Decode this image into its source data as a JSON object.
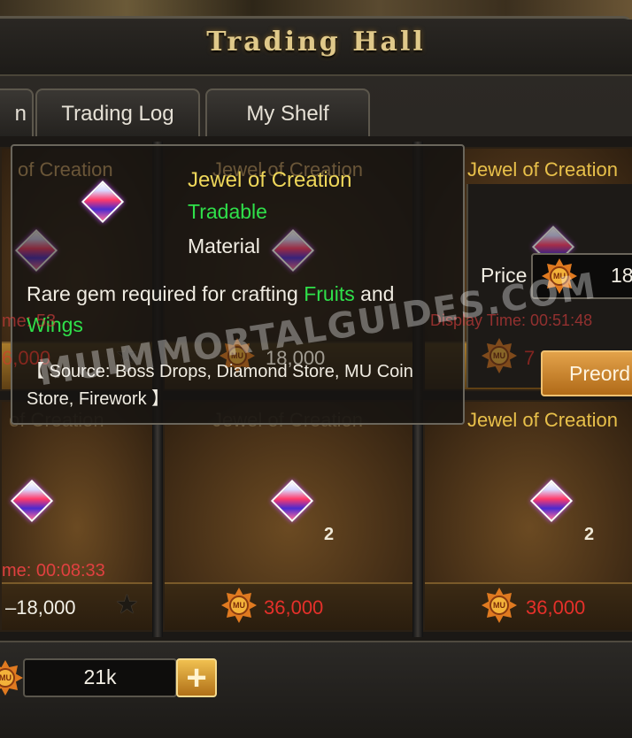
{
  "window": {
    "title": "Trading Hall"
  },
  "tabs": [
    {
      "label": "n"
    },
    {
      "label": "Trading Log"
    },
    {
      "label": "My Shelf"
    }
  ],
  "cards_top": [
    {
      "name": "of Creation",
      "timer": "me: 53",
      "price": "6,000"
    },
    {
      "name": "Jewel of Creation",
      "price": "18,000"
    },
    {
      "name": "Jewel of Creation",
      "timer": "Display Time: 00:51:48",
      "price": "7"
    }
  ],
  "cards_bottom": [
    {
      "name": "of Creation",
      "timer": "me:  00:08:33",
      "price": "18,000",
      "favorite": "star-icon"
    },
    {
      "name": "Jewel of Creation",
      "qty": "2",
      "price": "36,000"
    },
    {
      "name": "Jewel of Creation",
      "qty": "2",
      "price": "36,000"
    }
  ],
  "tooltip": {
    "item_name": "Jewel of Creation",
    "tradable": "Tradable",
    "type": "Material",
    "desc_pre": "Rare gem required for crafting ",
    "desc_fruits": "Fruits",
    "desc_and": " and",
    "desc_wings": "Wings",
    "source": "【 Source: Boss Drops, Diamond Store, MU Coin Store, Firework 】"
  },
  "purchase_panel": {
    "price_label": "Price",
    "price_value": "18,",
    "preorder_label": "Preord"
  },
  "bottom": {
    "balance": "21k",
    "plus": "+"
  },
  "watermark": "MUIMMORTALGUIDES.COM",
  "colors": {
    "accent_gold": "#e8c04a",
    "green": "#2fe04a",
    "red": "#e5302a"
  },
  "icons": {
    "currency": "mu-coin-icon",
    "item": "jewel-of-creation-icon",
    "favorite": "star-icon"
  }
}
